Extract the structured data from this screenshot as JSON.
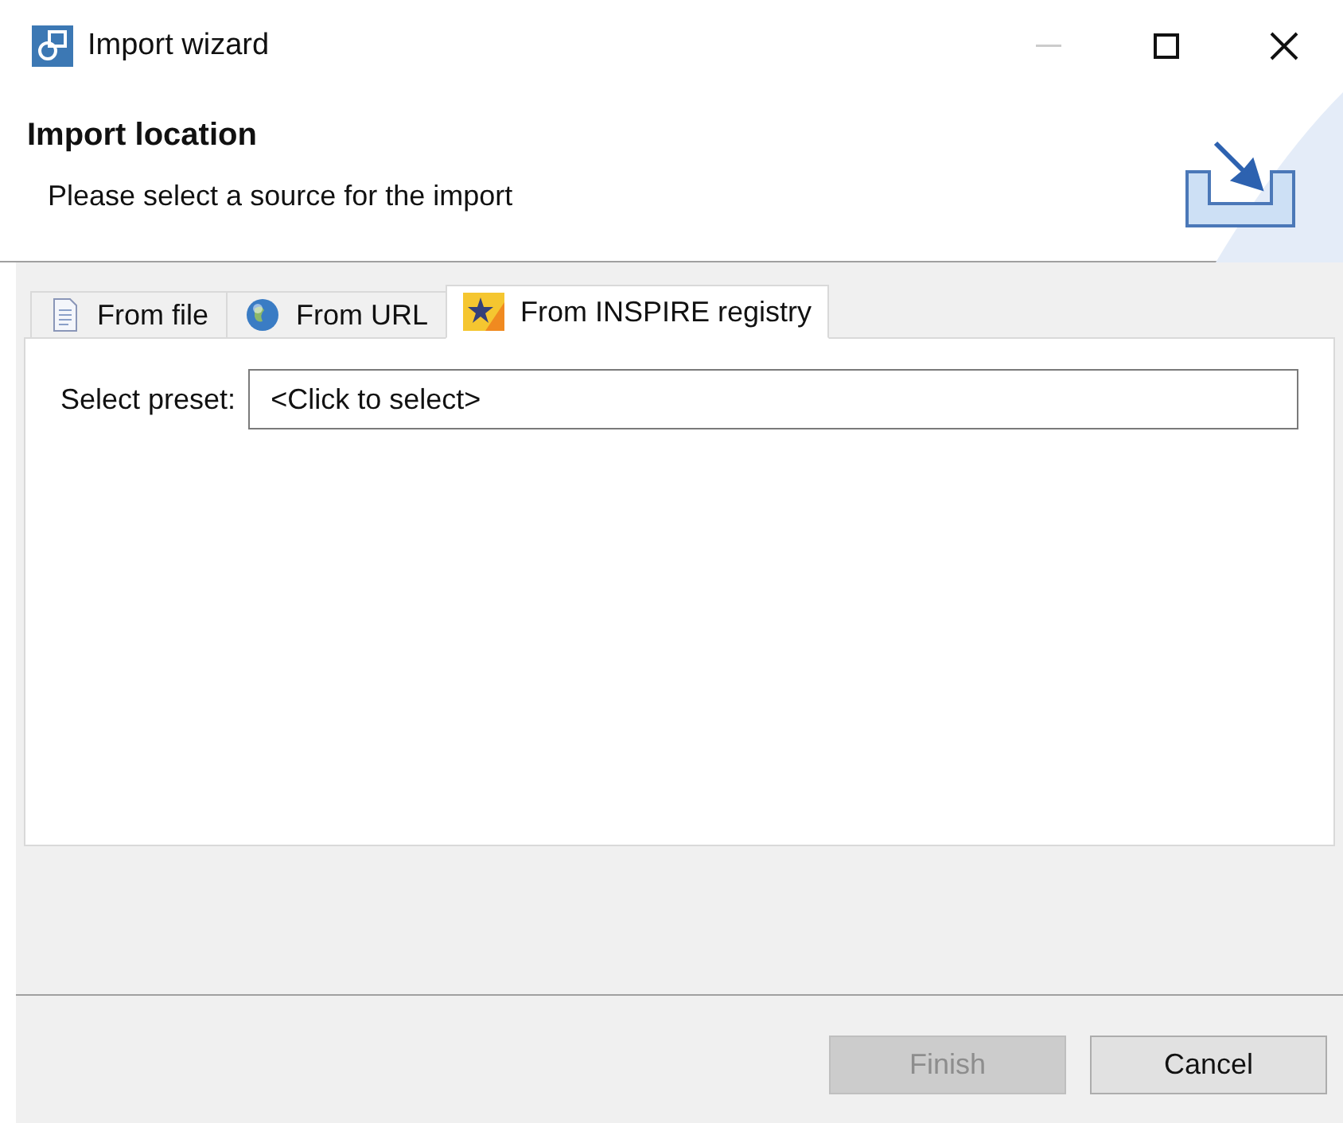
{
  "window": {
    "title": "Import wizard",
    "controls": [
      {
        "kind": "minimize",
        "disabled": true
      },
      {
        "kind": "maximize",
        "disabled": false
      },
      {
        "kind": "close",
        "disabled": false
      }
    ]
  },
  "header": {
    "title": "Import location",
    "message": "Please select a source for the import"
  },
  "tabs": [
    {
      "label": "From file",
      "kind": "file",
      "selected": false
    },
    {
      "label": "From URL",
      "kind": "globe",
      "selected": false
    },
    {
      "label": "From INSPIRE registry",
      "kind": "star",
      "selected": true
    }
  ],
  "form": {
    "label": "Select preset:",
    "value": "<Click to select>"
  },
  "buttons": [
    {
      "label": "Finish",
      "disabled": true
    },
    {
      "label": "Cancel",
      "disabled": false
    }
  ]
}
